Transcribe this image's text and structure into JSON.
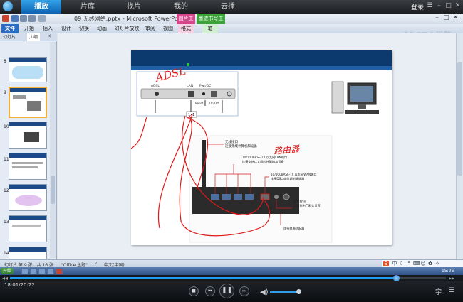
{
  "player": {
    "tabs": [
      {
        "label": "播放",
        "active": true
      },
      {
        "label": "片库",
        "active": false
      },
      {
        "label": "找片",
        "active": false
      },
      {
        "label": "我的",
        "active": false
      },
      {
        "label": "云播",
        "active": false
      }
    ],
    "login_label": "登录",
    "time_current": "18:01",
    "time_sep": "/",
    "time_total": "20:22",
    "progress": 0.885,
    "volume": 0.9,
    "accent": "#1f9df0"
  },
  "ppt": {
    "title": "09 无线网络.pptx - Microsoft PowerPoint",
    "context_tools": [
      "图片工具",
      "墨迹书写工具"
    ],
    "ribbon_tabs": [
      "文件",
      "开始",
      "插入",
      "设计",
      "切换",
      "动画",
      "幻灯片放映",
      "审阅",
      "视图",
      "格式",
      "笔"
    ],
    "left_panel_tabs": [
      "幻灯片",
      "大纲"
    ],
    "slide_numbers": [
      "8",
      "9",
      "10",
      "11",
      "12",
      "13",
      "14"
    ],
    "status": {
      "slide_info": "幻灯片 第 9 张，共 16 张",
      "theme": "\"Office 主题\"",
      "language": "中文(中国)"
    },
    "taskbar_start": "开始",
    "clock": "15:26",
    "watermark": "51CTO学院"
  },
  "slide": {
    "modem_labels": {
      "adsl": "ADSL",
      "lan": "LAN",
      "power": "Pwr/DC",
      "reset": "Reset",
      "onoff": "On/Off",
      "tag": "1x1"
    },
    "router_labels": {
      "antenna_1": "无线接口",
      "antenna_2": "连接无线计算机和设备",
      "lan_1": "10/100BASE-TX 以太网LAN端口",
      "lan_2": "连接支持以太网的计算机和设备",
      "wan_1": "10/100BASE-TX 以太网WAN端口",
      "wan_2": "连接DSL/电缆调制解调器",
      "reset_1": "复位按钮",
      "reset_2": "恢复到出厂默认设置",
      "power": "连接电源适配器"
    },
    "handwriting_1": "ADSL",
    "handwriting_2": "路由器"
  }
}
